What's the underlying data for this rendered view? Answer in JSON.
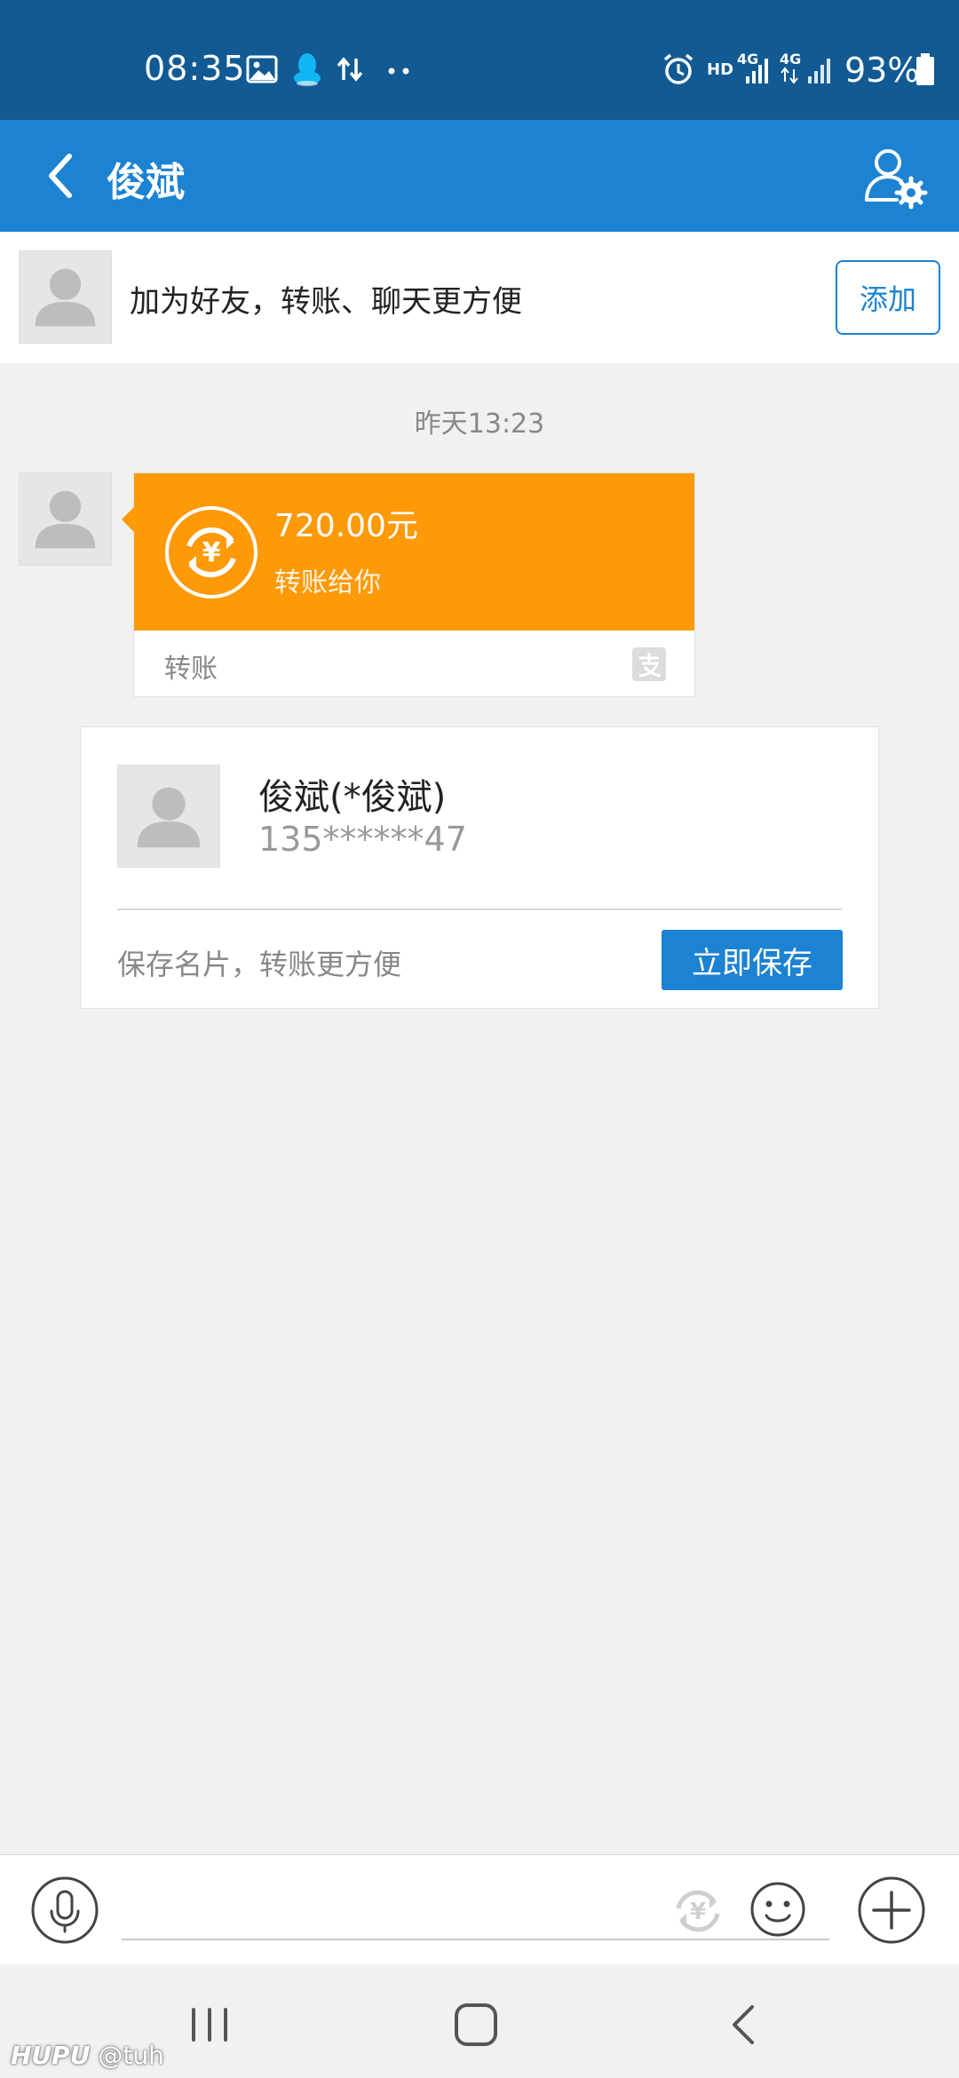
{
  "status_bar": {
    "time": "08:35",
    "network_hd": "HD",
    "network_4g_1": "4G",
    "network_4g_2": "4G",
    "battery": "93%"
  },
  "header": {
    "title": "俊斌"
  },
  "banner": {
    "text": "加为好友，转账、聊天更方便",
    "add_label": "添加"
  },
  "chat": {
    "timestamp": "昨天13:23",
    "transfer": {
      "amount": "720.00元",
      "description": "转账给你",
      "label": "转账"
    }
  },
  "contact_card": {
    "name": "俊斌(*俊斌)",
    "phone": "135******47",
    "hint": "保存名片，转账更方便",
    "save_label": "立即保存"
  },
  "input": {
    "placeholder": ""
  },
  "watermark": {
    "brand": "HUPU",
    "handle": "@tuh"
  },
  "colors": {
    "status_bar": "#115a93",
    "header": "#1c82d2",
    "accent": "#1c82d2",
    "transfer_orange": "#fe9908",
    "background": "#f1f1f1"
  },
  "icons": {
    "back": "chevron-left-icon",
    "profile_settings": "user-gear-icon",
    "transfer": "yuan-exchange-icon",
    "alipay": "alipay-logo-icon",
    "voice": "microphone-icon",
    "money": "yuan-exchange-icon",
    "emoji": "smiley-icon",
    "plus": "plus-circle-icon"
  }
}
